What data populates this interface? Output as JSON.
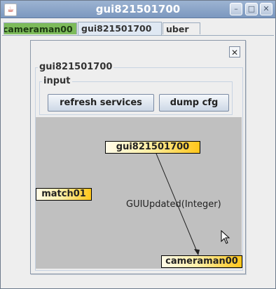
{
  "window": {
    "title": "gui821501700",
    "minimize": "–",
    "maximize": "□",
    "close": "✕"
  },
  "tabs": [
    "cameraman00",
    "gui821501700",
    "uber"
  ],
  "active_tab": 1,
  "frame": {
    "close": "✕",
    "group_title": "gui821501700",
    "input_group_title": "input",
    "refresh_button": "refresh services",
    "dump_button": "dump cfg"
  },
  "graph": {
    "nodes": {
      "gui": "gui821501700",
      "match": "match01",
      "camera": "cameraman00"
    },
    "edge_label": "GUIUpdated(Integer)"
  },
  "colors": {
    "graph_bg": "#c0c0c0",
    "node_gradient_end": "#ffc61a",
    "active_tab_green": "#7dbb5b",
    "titlebar": "#8aa5c9"
  },
  "icons": {
    "app": "java-cup-icon",
    "cursor": "mouse-pointer-icon"
  }
}
